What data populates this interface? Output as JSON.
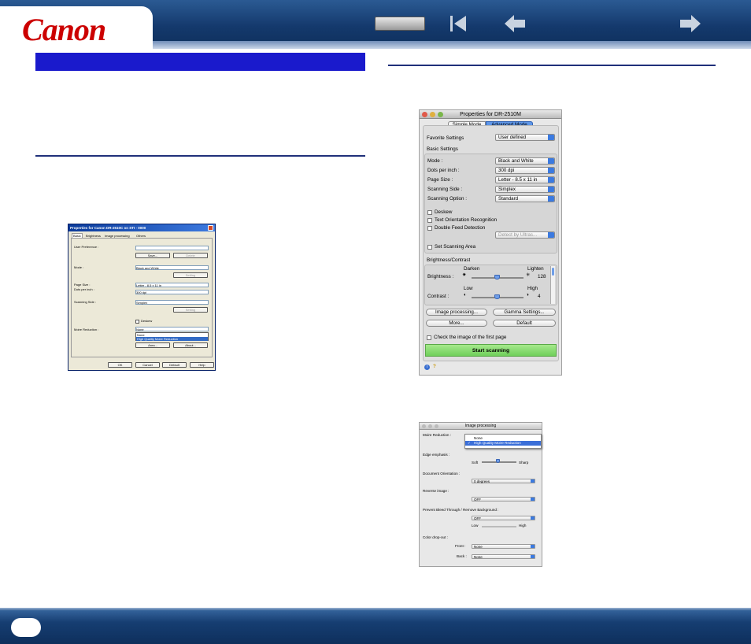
{
  "header": {
    "logo": "Canon",
    "accent": "#cc0000",
    "nav_icons": [
      "toc-button",
      "first-page-icon",
      "back-arrow-icon",
      "forward-arrow-icon"
    ]
  },
  "win_dialog": {
    "title": "Properties for Canon DR-2510C on STI - 0000",
    "tabs": [
      "Basic",
      "Brightness",
      "Image processing",
      "Others"
    ],
    "user_preference_label": "User Preference :",
    "save_btn": "Save...",
    "delete_btn": "Delete",
    "mode_label": "Mode :",
    "mode_value": "Black and White",
    "setting_btn": "Setting",
    "page_size_label": "Page Size :",
    "page_size_value": "Letter - 8.5 x 11 in",
    "dpi_label": "Dots per inch :",
    "dpi_value": "300 dpi",
    "scanning_side_label": "Scanning Side :",
    "scanning_side_value": "Simplex",
    "setting_btn2": "Setting",
    "deskew_label": "Deskew",
    "moire_label": "Moire Reduction :",
    "moire_value": "None",
    "moire_options": [
      "None",
      "High Quality Moire Reduction"
    ],
    "area_btn": "Area...",
    "about_btn": "About...",
    "ok_btn": "OK",
    "cancel_btn": "Cancel",
    "default_btn": "Default",
    "help_btn": "Help"
  },
  "mac_dialog": {
    "title": "Properties for DR-2510M",
    "tabs": [
      "Simple Mode",
      "Advanced Mode"
    ],
    "favorite_label": "Favorite Settings",
    "favorite_value": "User defined",
    "basic_settings": "Basic Settings",
    "mode_label": "Mode :",
    "mode_value": "Black and White",
    "dpi_label": "Dots per inch :",
    "dpi_value": "300 dpi",
    "page_size_label": "Page Size :",
    "page_size_value": "Letter - 8.5 x 11 in",
    "scanning_side_label": "Scanning Side :",
    "scanning_side_value": "Simplex",
    "scanning_option_label": "Scanning Option :",
    "scanning_option_value": "Standard",
    "deskew": "Deskew",
    "text_orientation": "Text Orientation Recognition",
    "double_feed": "Double Feed Detection",
    "detect_by": "Detect by Ultras...",
    "set_area": "Set Scanning Area",
    "brightness_contrast": "Brightness/Contrast",
    "darken": "Darken",
    "lighten": "Lighten",
    "brightness_label": "Brightness :",
    "brightness_value": "128",
    "low": "Low",
    "high": "High",
    "contrast_label": "Contrast :",
    "contrast_value": "4",
    "image_processing_btn": "Image processing...",
    "gamma_btn": "Gamma Settings...",
    "more_btn": "More...",
    "default_btn": "Default",
    "check_first_page": "Check the image of the first page",
    "start_scanning": "Start scanning"
  },
  "image_proc": {
    "title": "Image processing",
    "moire_label": "Moire Reduction :",
    "moire_options": [
      "None",
      "High Quality Moire Reduction"
    ],
    "edge_label": "Edge emphasis :",
    "soft": "Soft",
    "sharp": "Sharp",
    "doc_orientation_label": "Document Orientation :",
    "doc_orientation_value": "0 degrees",
    "reverse_label": "Reverse image :",
    "reverse_value": "OFF",
    "bleed_label": "Prevent Bleed Through / Remove Background :",
    "bleed_value": "OFF",
    "low": "Low",
    "high": "High",
    "dropout_label": "Color drop-out :",
    "front_label": "Front :",
    "front_value": "None",
    "back_label": "Back :",
    "back_value": "None"
  }
}
